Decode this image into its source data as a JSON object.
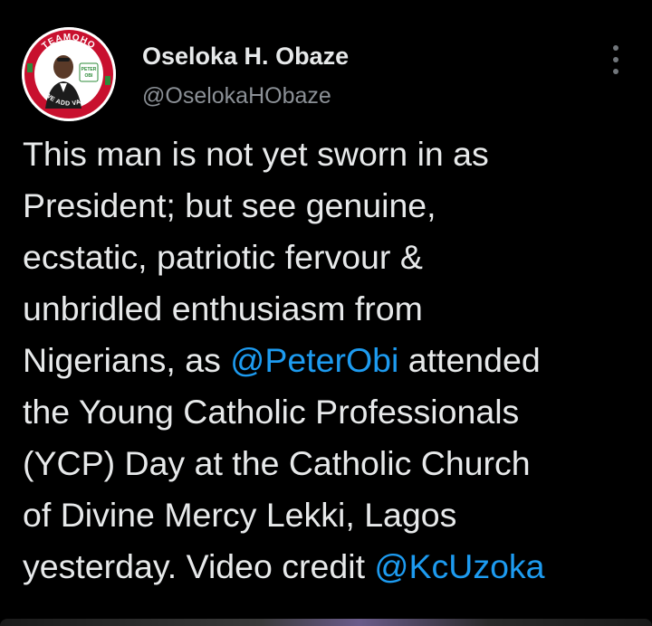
{
  "author": {
    "name": "Oseloka H. Obaze",
    "handle": "@OselokaHObaze",
    "avatar": {
      "ring_top_text": "TEAMOHO",
      "ring_bottom_text": "WE ADD VALUE",
      "badge_text": "PETER OBI"
    }
  },
  "menu": {
    "icon": "more-vertical-icon"
  },
  "tweet": {
    "lines": [
      [
        {
          "text": "This man is not yet sworn in as"
        }
      ],
      [
        {
          "text": "President; but see genuine,"
        }
      ],
      [
        {
          "text": "ecstatic, patriotic fervour &"
        }
      ],
      [
        {
          "text": "unbridled enthusiasm from"
        }
      ],
      [
        {
          "text": "Nigerians, as "
        },
        {
          "mention": "@PeterObi"
        },
        {
          "text": " attended"
        }
      ],
      [
        {
          "text": "the Young Catholic Professionals"
        }
      ],
      [
        {
          "text": "(YCP) Day at the Catholic Church"
        }
      ],
      [
        {
          "text": "of Divine Mercy Lekki, Lagos"
        }
      ],
      [
        {
          "text": "yesterday. Video credit "
        },
        {
          "mention": "@KcUzoka"
        }
      ]
    ]
  },
  "colors": {
    "background": "#000000",
    "text": "#e7e9ea",
    "secondary": "#8b9096",
    "mention": "#1d9bf0",
    "avatar_ring": "#c8102e",
    "avatar_accent": "#2e8b3a"
  }
}
